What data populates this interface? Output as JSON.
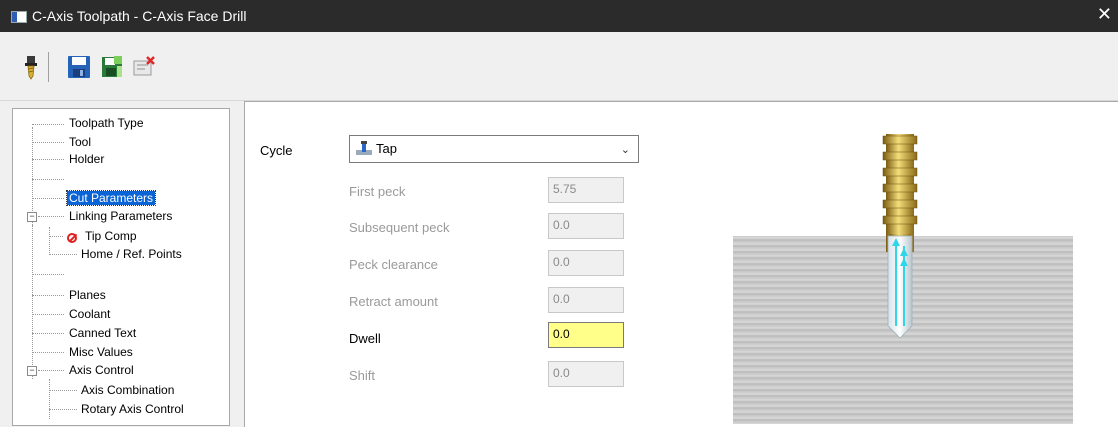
{
  "window": {
    "title": "C-Axis Toolpath - C-Axis Face Drill",
    "close_glyph": "✕"
  },
  "toolbar": {
    "icons": [
      "tool-icon",
      "save-icon",
      "save-as-icon",
      "delete-icon"
    ]
  },
  "tree": {
    "items": [
      {
        "label": "Toolpath Type"
      },
      {
        "label": "Tool"
      },
      {
        "label": "Holder"
      },
      {
        "label": "Cut Parameters"
      },
      {
        "label": "Linking Parameters"
      },
      {
        "label": "Tip Comp"
      },
      {
        "label": "Home / Ref. Points"
      },
      {
        "label": "Planes"
      },
      {
        "label": "Coolant"
      },
      {
        "label": "Canned Text"
      },
      {
        "label": "Misc Values"
      },
      {
        "label": "Axis Control"
      },
      {
        "label": "Axis Combination"
      },
      {
        "label": "Rotary Axis Control"
      }
    ],
    "expander_glyph": "−"
  },
  "params": {
    "cycle_label": "Cycle",
    "cycle_value": "Tap",
    "chevron": "⌄",
    "first_peck": {
      "label": "First peck",
      "value": "5.75"
    },
    "subsequent_peck": {
      "label": "Subsequent peck",
      "value": "0.0"
    },
    "peck_clearance": {
      "label": "Peck clearance",
      "value": "0.0"
    },
    "retract_amount": {
      "label": "Retract amount",
      "value": "0.0"
    },
    "dwell": {
      "label": "Dwell",
      "value": "0.0"
    },
    "shift": {
      "label": "Shift",
      "value": "0.0"
    }
  },
  "colors": {
    "selection": "#0a64d6",
    "active_field": "#ffff8a",
    "tip_comp_icon": "#e02020",
    "arrow": "#2fd6ea"
  }
}
